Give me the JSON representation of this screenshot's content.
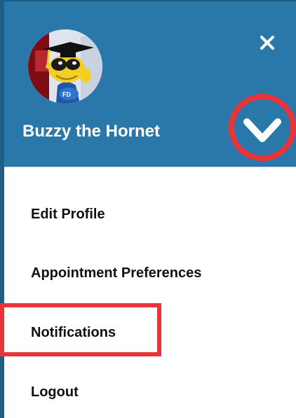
{
  "header": {
    "user_name": "Buzzy the Hornet",
    "close_icon": "close-icon",
    "chevron_icon": "chevron-down-icon",
    "avatar_icon": "mascot-avatar"
  },
  "menu": {
    "items": [
      {
        "label": "Edit Profile"
      },
      {
        "label": "Appointment Preferences"
      },
      {
        "label": "Notifications"
      },
      {
        "label": "Logout"
      }
    ]
  },
  "colors": {
    "header_bg": "#2a78aa",
    "annotation_red": "#e9343c",
    "menu_text": "#111111"
  }
}
